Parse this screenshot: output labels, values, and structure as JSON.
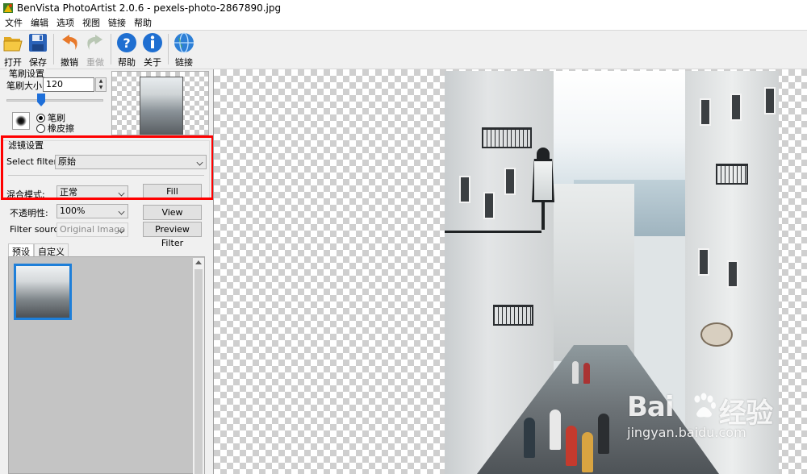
{
  "window": {
    "title": "BenVista PhotoArtist 2.0.6 - pexels-photo-2867890.jpg"
  },
  "menu": [
    "文件",
    "编辑",
    "选项",
    "视图",
    "链接",
    "帮助"
  ],
  "toolbar": {
    "open": "打开",
    "save": "保存",
    "undo": "撤销",
    "redo": "重做",
    "help": "帮助",
    "about": "关于",
    "link": "链接"
  },
  "brush_settings": {
    "title": "笔刷设置",
    "size_label": "笔刷大小:",
    "size_value": "120",
    "size_slider_fraction": 0.35,
    "mode_brush": "笔刷",
    "mode_eraser": "橡皮擦",
    "selected_mode": "brush"
  },
  "filter_settings": {
    "title": "滤镜设置",
    "select_filter_label": "Select filter:",
    "select_filter_value": "原始",
    "blend_mode_label": "混合模式:",
    "blend_mode_value": "正常",
    "fill_button": "Fill",
    "opacity_label": "不透明性:",
    "opacity_value": "100%",
    "filter_source_label": "Filter source:",
    "filter_source_value": "Original Image",
    "view_original_button": "View Original",
    "preview_filter_button": "Preview Filter"
  },
  "tabs": [
    "预设",
    "自定义"
  ],
  "active_tab": "预设",
  "watermark": {
    "brand_left": "Bai",
    "brand_right": "经验",
    "url": "jingyan.baidu.com"
  },
  "colors": {
    "highlight_box": "#ff0000",
    "selection": "#1e7fd9",
    "slider_thumb": "#1e6fd9"
  },
  "icons": [
    "folder-open-icon",
    "floppy-save-icon",
    "undo-arrow-icon",
    "redo-arrow-icon",
    "help-question-icon",
    "info-icon",
    "globe-link-icon"
  ]
}
